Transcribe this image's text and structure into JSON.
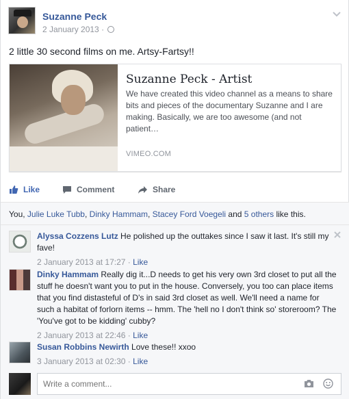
{
  "post": {
    "author": "Suzanne Peck",
    "date": "2 January 2013",
    "separator": " · ",
    "text": "2 little 30 second films on me. Artsy-Fartsy!!"
  },
  "link_card": {
    "title": "Suzanne Peck - Artist",
    "description": "We have created this video channel as a means to share bits and pieces of the documentary Suzanne and I are making. Basically, we are too awesome (and not patient…",
    "domain": "VIMEO.COM"
  },
  "actions": {
    "like": "Like",
    "comment": "Comment",
    "share": "Share"
  },
  "likes": {
    "you": "You, ",
    "names": [
      "Julie Luke Tubb",
      "Dinky Hammam",
      "Stacey Ford Voegeli"
    ],
    "sep": ", ",
    "and": " and ",
    "others": "5 others",
    "suffix": " like this."
  },
  "comments": [
    {
      "name": "Alyssa Cozzens Lutz",
      "text": "He polished up the outtakes since I saw it last. It's still my fave!",
      "time": "2 January 2013 at 17:27",
      "like": "Like"
    },
    {
      "name": "Dinky Hammam",
      "text": "Really dig it...D needs to get his very own 3rd closet to put all the stuff he doesn't want you to put in the house. Conversely, you too can place items that you find distasteful of D's in said 3rd closet as well. We'll need a name for such a habitat of forlorn items -- hmm. The 'hell no I don't think so' storeroom? The 'You've got to be kidding' cubby?",
      "time": "2 January 2013 at 22:46",
      "like": "Like"
    },
    {
      "name": "Susan Robbins Newirth",
      "text": "Love these!! xxoo",
      "time": "3 January 2013 at 02:30",
      "like": "Like"
    }
  ],
  "meta_separator": " · ",
  "write_comment": {
    "placeholder": "Write a comment..."
  },
  "colors": {
    "link": "#365899",
    "like_blue": "#4267b2",
    "meta_gray": "#90949c",
    "background_gray": "#f6f7f9"
  }
}
